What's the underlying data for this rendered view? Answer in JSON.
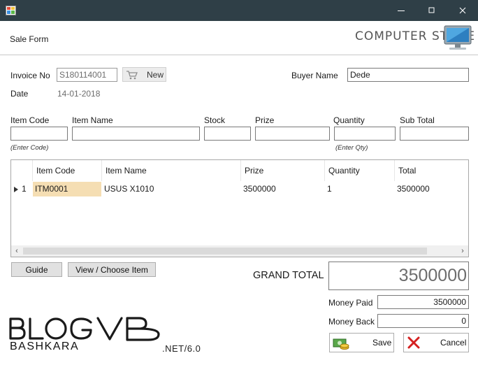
{
  "window": {
    "title": ""
  },
  "header": {
    "form_title": "Sale Form",
    "logo_text": "COMPUTER STORE"
  },
  "invoice": {
    "invoice_label": "Invoice No",
    "invoice_value": "S180114001",
    "new_button": "New",
    "date_label": "Date",
    "date_value": "14-01-2018",
    "buyer_label": "Buyer Name",
    "buyer_value": "Dede"
  },
  "entry": {
    "item_code_label": "Item Code",
    "item_name_label": "Item Name",
    "stock_label": "Stock",
    "prize_label": "Prize",
    "quantity_label": "Quantity",
    "subtotal_label": "Sub Total",
    "item_code_value": "",
    "item_name_value": "",
    "stock_value": "",
    "prize_value": "",
    "quantity_value": "",
    "subtotal_value": "",
    "code_hint": "(Enter Code)",
    "qty_hint": "(Enter Qty)"
  },
  "grid": {
    "columns": [
      "Item Code",
      "Item Name",
      "Prize",
      "Quantity",
      "Total"
    ],
    "rows": [
      {
        "no": "1",
        "item_code": "ITM0001",
        "item_name": "USUS X1010",
        "prize": "3500000",
        "quantity": "1",
        "total": "3500000"
      }
    ],
    "left_arrow": "‹",
    "right_arrow": "›"
  },
  "buttons": {
    "guide": "Guide",
    "view_choose": "View / Choose Item",
    "save": "Save",
    "cancel": "Cancel"
  },
  "totals": {
    "grand_total_label": "GRAND TOTAL",
    "grand_total_value": "3500000",
    "money_paid_label": "Money Paid",
    "money_paid_value": "3500000",
    "money_back_label": "Money Back",
    "money_back_value": "0"
  },
  "brand": {
    "main": "BLOGVB",
    "sub": "BASHKARA",
    "net": ".NET/6.0"
  },
  "colors": {
    "titlebar": "#2f3f47",
    "selected_cell": "#f5deb3",
    "cancel_x": "#d42020"
  }
}
